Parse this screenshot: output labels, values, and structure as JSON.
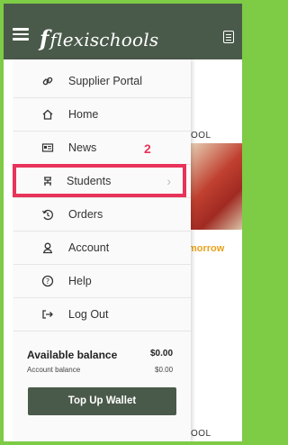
{
  "header": {
    "brand": "flexischools",
    "brand_initial": "f"
  },
  "background": {
    "school_1": "OOL",
    "school_2": "OOL",
    "tomorrow": "morrow"
  },
  "menu": {
    "items": [
      {
        "label": "Supplier Portal",
        "icon": "link-icon"
      },
      {
        "label": "Home",
        "icon": "home-icon"
      },
      {
        "label": "News",
        "icon": "news-icon"
      },
      {
        "label": "Students",
        "icon": "students-icon"
      },
      {
        "label": "Orders",
        "icon": "orders-icon"
      },
      {
        "label": "Account",
        "icon": "account-icon"
      },
      {
        "label": "Help",
        "icon": "help-icon"
      },
      {
        "label": "Log Out",
        "icon": "logout-icon"
      }
    ]
  },
  "annotation": {
    "step": "2"
  },
  "balance": {
    "title": "Available balance",
    "amount": "$0.00",
    "sub_label": "Account balance",
    "sub_amount": "$0.00",
    "topup_label": "Top Up Wallet"
  },
  "colors": {
    "header": "#4a5a4a",
    "frame": "#7ecb46",
    "highlight": "#e8335a",
    "tomorrow": "#e9a21b"
  }
}
